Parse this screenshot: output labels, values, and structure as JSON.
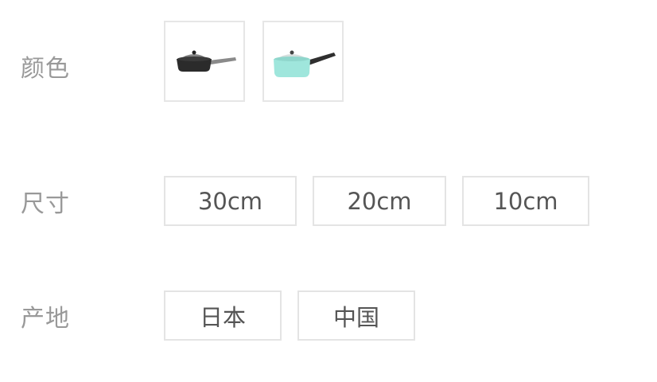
{
  "color": {
    "label": "颜色",
    "options": [
      {
        "icon": "black-frying-pan-icon",
        "body_color": "#2b2b2b",
        "handle_color": "#8a8a8a"
      },
      {
        "icon": "mint-saucepan-icon",
        "body_color": "#9fe6dc",
        "handle_color": "#2f2f2f"
      }
    ]
  },
  "size": {
    "label": "尺寸",
    "options": [
      "30cm",
      "20cm",
      "10cm"
    ]
  },
  "origin": {
    "label": "产地",
    "options": [
      "日本",
      "中国"
    ]
  }
}
